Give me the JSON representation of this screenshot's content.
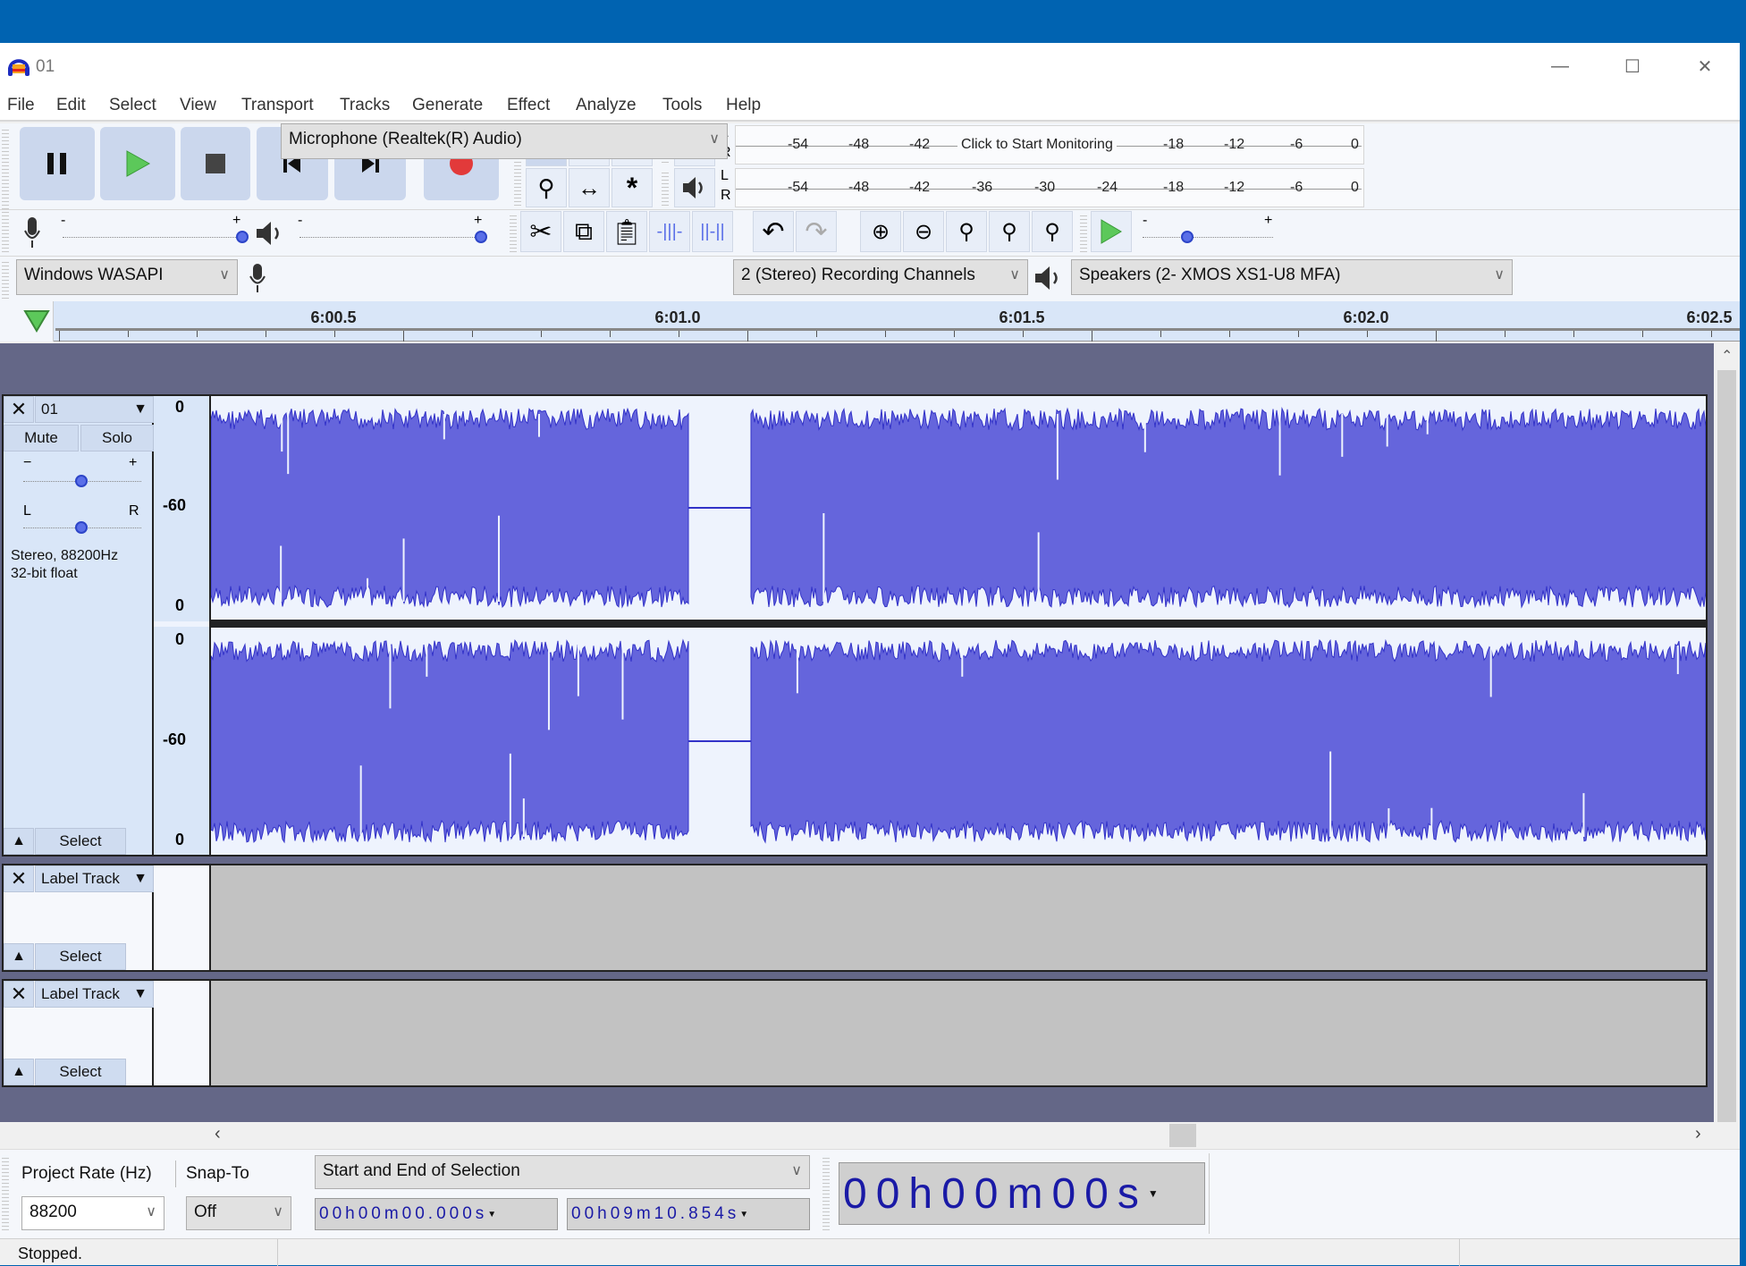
{
  "window": {
    "title": "01",
    "minimize_label": "—",
    "maximize_label": "☐",
    "close_label": "✕"
  },
  "menu": [
    "File",
    "Edit",
    "Select",
    "View",
    "Transport",
    "Tracks",
    "Generate",
    "Effect",
    "Analyze",
    "Tools",
    "Help"
  ],
  "transport": {
    "icons": [
      "pause-icon",
      "play-icon",
      "stop-icon",
      "skip-to-start-icon",
      "skip-to-end-icon",
      "record-icon"
    ]
  },
  "tools": {
    "icons": [
      "selection-tool-icon",
      "envelope-tool-icon",
      "draw-tool-icon",
      "zoom-tool-icon",
      "time-shift-tool-icon",
      "multi-tool-icon"
    ]
  },
  "meters": {
    "record": {
      "L": "L",
      "R": "R",
      "ticks": [
        "-54",
        "-48",
        "-42",
        "-18",
        "-12",
        "-6",
        "0"
      ],
      "prompt": "Click to Start Monitoring"
    },
    "playback": {
      "L": "L",
      "R": "R",
      "ticks": [
        "-54",
        "-48",
        "-42",
        "-36",
        "-30",
        "-24",
        "-18",
        "-12",
        "-6",
        "0"
      ]
    }
  },
  "mixer": {
    "rec_minus": "-",
    "rec_plus": "+",
    "play_minus": "-",
    "play_plus": "+",
    "rec_volume": 1.0,
    "play_volume": 1.0
  },
  "playspeed": {
    "minus": "-",
    "plus": "+",
    "value": 0.3
  },
  "devices": {
    "host": "Windows WASAPI",
    "input": "Microphone (Realtek(R) Audio)",
    "channels": "2 (Stereo) Recording Channels",
    "output": "Speakers (2- XMOS XS1-U8 MFA)"
  },
  "ruler": {
    "labels": [
      "6:00.5",
      "6:01.0",
      "6:01.5",
      "6:02.0",
      "6:02.5"
    ]
  },
  "audio_track": {
    "name": "01",
    "mute": "Mute",
    "solo": "Solo",
    "gain_minus": "−",
    "gain_plus": "+",
    "pan_left": "L",
    "pan_right": "R",
    "gain": 0.5,
    "pan": 0.5,
    "info1": "Stereo, 88200Hz",
    "info2": "32-bit float",
    "select": "Select",
    "scale": [
      "0",
      "-60",
      "0"
    ]
  },
  "label_tracks": [
    {
      "name": "Label Track",
      "select": "Select"
    },
    {
      "name": "Label Track",
      "select": "Select"
    }
  ],
  "selection_toolbar": {
    "rate_label": "Project Rate (Hz)",
    "snap_label": "Snap-To",
    "rate_value": "88200",
    "snap_value": "Off",
    "selection_mode": "Start and End of Selection",
    "start": "00h00m00.000s",
    "end": "00h09m10.854s",
    "position": "00h00m00s"
  },
  "status": {
    "text": "Stopped."
  },
  "colors": {
    "waveform": "#6565dc",
    "waveform_edge": "#3232c8",
    "track_bg": "#646787",
    "titlebar": "#0063b1"
  }
}
